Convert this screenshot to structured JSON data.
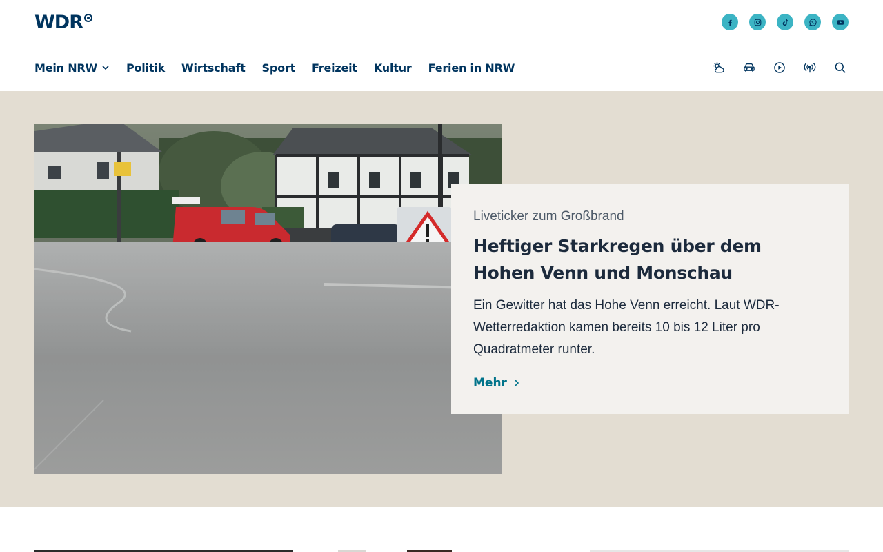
{
  "brand": {
    "logo_text": "WDR"
  },
  "social": [
    {
      "name": "facebook",
      "icon": "facebook-icon"
    },
    {
      "name": "instagram",
      "icon": "instagram-icon"
    },
    {
      "name": "tiktok",
      "icon": "tiktok-icon"
    },
    {
      "name": "whatsapp",
      "icon": "whatsapp-icon"
    },
    {
      "name": "youtube",
      "icon": "youtube-icon"
    }
  ],
  "nav": {
    "items": [
      {
        "label": "Mein NRW"
      },
      {
        "label": "Politik"
      },
      {
        "label": "Wirtschaft"
      },
      {
        "label": "Sport"
      },
      {
        "label": "Freizeit"
      },
      {
        "label": "Kultur"
      },
      {
        "label": "Ferien in NRW"
      }
    ]
  },
  "tools": [
    "weather-icon",
    "traffic-icon",
    "play-icon",
    "radio-icon",
    "search-icon"
  ],
  "hero": {
    "kicker": "Liveticker zum Großbrand",
    "headline": "Heftiger Starkregen über dem Hohen Venn und Monschau",
    "teaser": "Ein Gewitter hat das Hohe Venn erreicht. Laut WDR-Wetterredaktion kamen bereits 10 bis 12 Liter pro Quadratmeter runter.",
    "more_label": "Mehr"
  },
  "colors": {
    "brand_blue": "#00345e",
    "social_teal": "#3cb4c4",
    "hero_bg": "#e3ddd2",
    "card_bg": "#f3f1ee",
    "link": "#00738a"
  }
}
